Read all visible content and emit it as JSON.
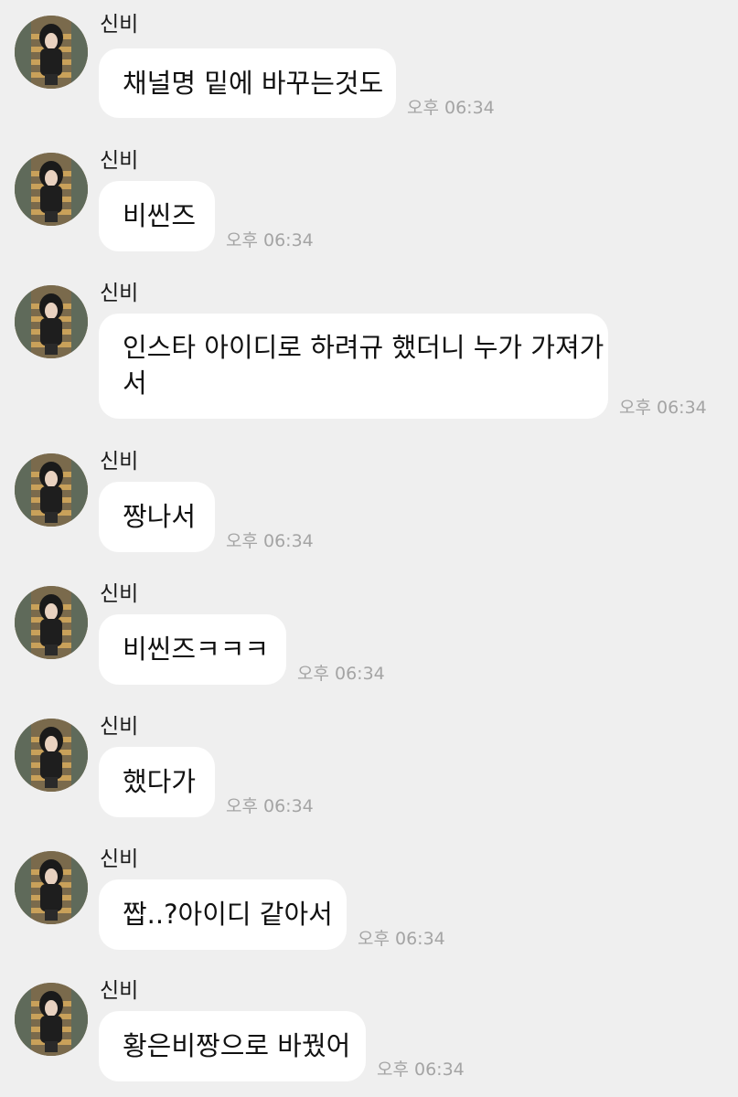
{
  "messages": [
    {
      "sender": "신비",
      "text": "채널명 밑에 바꾸는것도",
      "time": "오후 06:34"
    },
    {
      "sender": "신비",
      "text": "비씬즈",
      "time": "오후 06:34"
    },
    {
      "sender": "신비",
      "text_line1": "인스타 아이디로 하려규 했더니 누가 가져가",
      "text_line2": "서",
      "time": "오후 06:34"
    },
    {
      "sender": "신비",
      "text": "짱나서",
      "time": "오후 06:34"
    },
    {
      "sender": "신비",
      "text": "비씬즈ㅋㅋㅋ",
      "time": "오후 06:34"
    },
    {
      "sender": "신비",
      "text": "했다가",
      "time": "오후 06:34"
    },
    {
      "sender": "신비",
      "text": "짭..?아이디 같아서",
      "time": "오후 06:34"
    },
    {
      "sender": "신비",
      "text": "황은비짱으로 바꿨어",
      "time": "오후 06:34"
    }
  ]
}
